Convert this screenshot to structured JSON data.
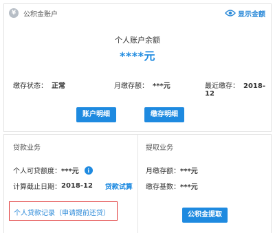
{
  "account": {
    "logo_glyph": "¥",
    "title": "公积金账户",
    "show_amount_label": "显示金额",
    "balance_title": "个人账户余额",
    "balance_value": "****元",
    "status_label": "缴存状态：",
    "status_value": "正常",
    "monthly_label": "月缴存额：",
    "monthly_value": "***元",
    "last_label": "最近缴存：",
    "last_value": "2018-12",
    "btn_account_detail": "账户明细",
    "btn_deposit_detail": "缴存明细"
  },
  "loan": {
    "title": "贷款业务",
    "available_label": "个人可贷额度：",
    "available_value": "***元",
    "deadline_label": "计算截止日期：",
    "deadline_value": "2018-12",
    "calc_link": "贷款试算",
    "record_link": "个人贷款记录（申请提前还贷）"
  },
  "withdraw": {
    "title": "提取业务",
    "monthly_label": "月缴存额：",
    "monthly_value": "***元",
    "base_label": "缴存基数：",
    "base_value": "***元",
    "btn_withdraw": "公积金提取"
  },
  "colors": {
    "accent": "#1e8ae0",
    "highlight_border": "#e03b3b"
  },
  "icons": [
    "yuan-logo-icon",
    "eye-icon",
    "info-icon"
  ]
}
